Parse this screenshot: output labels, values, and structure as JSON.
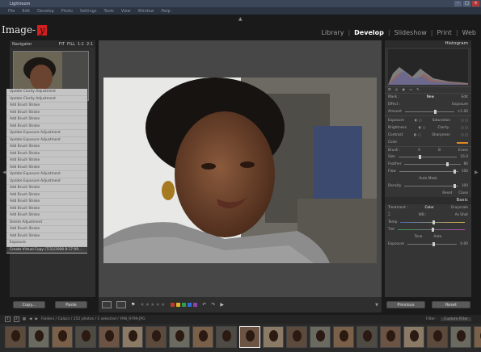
{
  "window": {
    "title": "Lightroom"
  },
  "menus": [
    "File",
    "Edit",
    "Develop",
    "Photo",
    "Settings",
    "Tools",
    "View",
    "Window",
    "Help"
  ],
  "identity": {
    "brand": "Image-",
    "logo_letter": "y"
  },
  "modules": {
    "items": [
      "Library",
      "Develop",
      "Slideshow",
      "Print",
      "Web"
    ],
    "active": "Develop"
  },
  "navigator": {
    "title": "Navigator",
    "zoom_options": [
      "FIT",
      "FILL",
      "1:1",
      "2:1"
    ]
  },
  "history": [
    "Update Clarity Adjustment",
    "Update Clarity Adjustment",
    "Add Brush Stroke",
    "Add Brush Stroke",
    "Add Brush Stroke",
    "Add Brush Stroke",
    "Update Exposure Adjustment",
    "Update Exposure Adjustment",
    "Add Brush Stroke",
    "Add Brush Stroke",
    "Add Brush Stroke",
    "Add Brush Stroke",
    "Update Exposure Adjustment",
    "Update Exposure Adjustment",
    "Add Brush Stroke",
    "Add Brush Stroke",
    "Add Brush Stroke",
    "Add Brush Stroke",
    "Add Brush Stroke",
    "Delete Adjustment",
    "Add Brush Stroke",
    "Add Brush Stroke",
    "Exposure",
    "Create Virtual Copy (7/31/2008 8:17:09..."
  ],
  "history_selected_index": 23,
  "left_buttons": {
    "copy": "Copy...",
    "paste": "Paste"
  },
  "histogram": {
    "title": "Histogram"
  },
  "adjustments": {
    "mask_label": "Mask :",
    "mask_new": "New",
    "mask_edit": "Edit",
    "effect_label": "Effect :",
    "effect_value": "Exposure",
    "amount_label": "Amount",
    "amount_value": "+1.00",
    "rows": [
      {
        "left": "Exposure",
        "right": "Saturation"
      },
      {
        "left": "Brightness",
        "right": "Clarity"
      },
      {
        "left": "Contrast",
        "right": "Sharpness"
      }
    ],
    "color_label": "Color",
    "brush_label": "Brush :",
    "brush_a": "A",
    "brush_b": "B",
    "brush_erase": "Erase",
    "size_label": "Size",
    "size_value": "16.0",
    "feather_label": "Feather",
    "feather_value": "80",
    "flow_label": "Flow",
    "flow_value": "100",
    "automask_label": "Auto Mask",
    "density_label": "Density",
    "density_value": "100",
    "reset": "Reset",
    "close": "Close"
  },
  "basic": {
    "title": "Basic",
    "treatment_label": "Treatment :",
    "treatment_color": "Color",
    "treatment_gray": "Grayscale",
    "wb_label": "WB :",
    "wb_value": "As Shot",
    "temp_label": "Temp",
    "tint_label": "Tint",
    "tone_label": "Tone",
    "tone_auto": "Auto",
    "exposure_label": "Exposure",
    "exposure_value": "0.00"
  },
  "right_buttons": {
    "previous": "Previous",
    "reset": "Reset"
  },
  "filmstrip_bar": {
    "page_numbers": [
      "1",
      "2"
    ],
    "path": "Folders / Calacs / 152 photos / 1 selected / YAN_9799.JPG",
    "filter_label": "Filter :",
    "filter_value": "Custom Filter"
  },
  "filmstrip_count": 21,
  "filmstrip_selected": 10,
  "colors": {
    "brand_red": "#d21f1f",
    "panel": "#353535",
    "center": "#474747"
  },
  "label_colors": [
    "#c0392b",
    "#e0b32a",
    "#2e9e4a",
    "#2d6fd6",
    "#8e44ad"
  ],
  "stars": "★★★★★"
}
